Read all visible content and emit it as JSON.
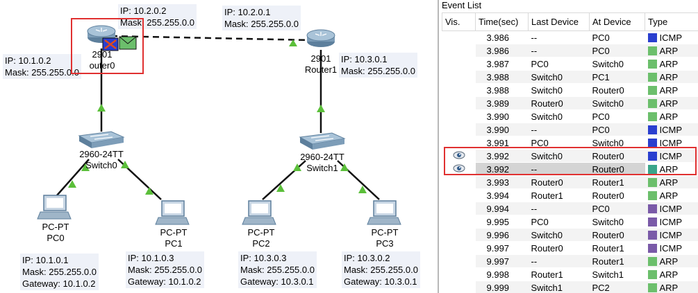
{
  "topology": {
    "router0": {
      "model": "2901",
      "name": "Router0",
      "name_visible": "outer0",
      "ip_g00": "IP: 10.1.0.2",
      "mask_g00": "Mask: 255.255.0.0",
      "ip_g01": "IP: 10.2.0.2",
      "mask_g01": "Mask: 255.255.0.0"
    },
    "router1": {
      "model": "2901",
      "name": "Router1",
      "ip_g00": "IP: 10.2.0.1",
      "mask_g00": "Mask: 255.255.0.0",
      "ip_g01": "IP: 10.3.0.1",
      "mask_g01": "Mask: 255.255.0.0"
    },
    "switch0": {
      "model": "2960-24TT",
      "name": "Switch0"
    },
    "switch1": {
      "model": "2960-24TT",
      "name": "Switch1"
    },
    "pc0": {
      "model": "PC-PT",
      "name": "PC0",
      "ip": "IP: 10.1.0.1",
      "mask": "Mask: 255.255.0.0",
      "gateway": "Gateway: 10.1.0.2"
    },
    "pc1": {
      "model": "PC-PT",
      "name": "PC1",
      "ip": "IP: 10.1.0.3",
      "mask": "Mask: 255.255.0.0",
      "gateway": "Gateway: 10.1.0.2"
    },
    "pc2": {
      "model": "PC-PT",
      "name": "PC2",
      "ip": "IP: 10.3.0.3",
      "mask": "Mask: 255.255.0.0",
      "gateway": "Gateway: 10.3.0.1"
    },
    "pc3": {
      "model": "PC-PT",
      "name": "PC3",
      "ip": "IP: 10.3.0.2",
      "mask": "Mask: 255.255.0.0",
      "gateway": "Gateway: 10.3.0.1"
    },
    "colors": {
      "link_light": "#5bbf3a",
      "serial_link": "#000000",
      "highlight": "#e03030",
      "router_body": "#7d9db8",
      "switch_body": "#6f8fa8"
    }
  },
  "event_list": {
    "title": "Event List",
    "columns": {
      "vis": "Vis.",
      "time": "Time(sec)",
      "last": "Last Device",
      "at": "At Device",
      "type": "Type"
    },
    "colors": {
      "icmp": "#2a3fcf",
      "arp": "#6cbf6c",
      "arp_teal": "#3aa58a",
      "icmp_purple": "#7a5aa8",
      "arp_green2": "#5aa05a"
    },
    "rows": [
      {
        "vis": "",
        "time": "3.986",
        "last": "--",
        "at": "PC0",
        "type": "ICMP",
        "color": "#2a3fcf"
      },
      {
        "vis": "",
        "time": "3.986",
        "last": "--",
        "at": "PC0",
        "type": "ARP",
        "color": "#6cbf6c"
      },
      {
        "vis": "",
        "time": "3.987",
        "last": "PC0",
        "at": "Switch0",
        "type": "ARP",
        "color": "#6cbf6c"
      },
      {
        "vis": "",
        "time": "3.988",
        "last": "Switch0",
        "at": "PC1",
        "type": "ARP",
        "color": "#6cbf6c"
      },
      {
        "vis": "",
        "time": "3.988",
        "last": "Switch0",
        "at": "Router0",
        "type": "ARP",
        "color": "#6cbf6c"
      },
      {
        "vis": "",
        "time": "3.989",
        "last": "Router0",
        "at": "Switch0",
        "type": "ARP",
        "color": "#6cbf6c"
      },
      {
        "vis": "",
        "time": "3.990",
        "last": "Switch0",
        "at": "PC0",
        "type": "ARP",
        "color": "#6cbf6c"
      },
      {
        "vis": "",
        "time": "3.990",
        "last": "--",
        "at": "PC0",
        "type": "ICMP",
        "color": "#2a3fcf"
      },
      {
        "vis": "",
        "time": "3.991",
        "last": "PC0",
        "at": "Switch0",
        "type": "ICMP",
        "color": "#2a3fcf"
      },
      {
        "vis": "eye",
        "time": "3.992",
        "last": "Switch0",
        "at": "Router0",
        "type": "ICMP",
        "color": "#2a3fcf"
      },
      {
        "vis": "eye",
        "time": "3.992",
        "last": "--",
        "at": "Router0",
        "type": "ARP",
        "color": "#3aa58a"
      },
      {
        "vis": "",
        "time": "3.993",
        "last": "Router0",
        "at": "Router1",
        "type": "ARP",
        "color": "#6cbf6c"
      },
      {
        "vis": "",
        "time": "3.994",
        "last": "Router1",
        "at": "Router0",
        "type": "ARP",
        "color": "#6cbf6c"
      },
      {
        "vis": "",
        "time": "9.994",
        "last": "--",
        "at": "PC0",
        "type": "ICMP",
        "color": "#7a5aa8"
      },
      {
        "vis": "",
        "time": "9.995",
        "last": "PC0",
        "at": "Switch0",
        "type": "ICMP",
        "color": "#7a5aa8"
      },
      {
        "vis": "",
        "time": "9.996",
        "last": "Switch0",
        "at": "Router0",
        "type": "ICMP",
        "color": "#7a5aa8"
      },
      {
        "vis": "",
        "time": "9.997",
        "last": "Router0",
        "at": "Router1",
        "type": "ICMP",
        "color": "#7a5aa8"
      },
      {
        "vis": "",
        "time": "9.997",
        "last": "--",
        "at": "Router1",
        "type": "ARP",
        "color": "#6cbf6c"
      },
      {
        "vis": "",
        "time": "9.998",
        "last": "Router1",
        "at": "Switch1",
        "type": "ARP",
        "color": "#6cbf6c"
      },
      {
        "vis": "",
        "time": "9.999",
        "last": "Switch1",
        "at": "PC2",
        "type": "ARP",
        "color": "#6cbf6c"
      }
    ]
  }
}
